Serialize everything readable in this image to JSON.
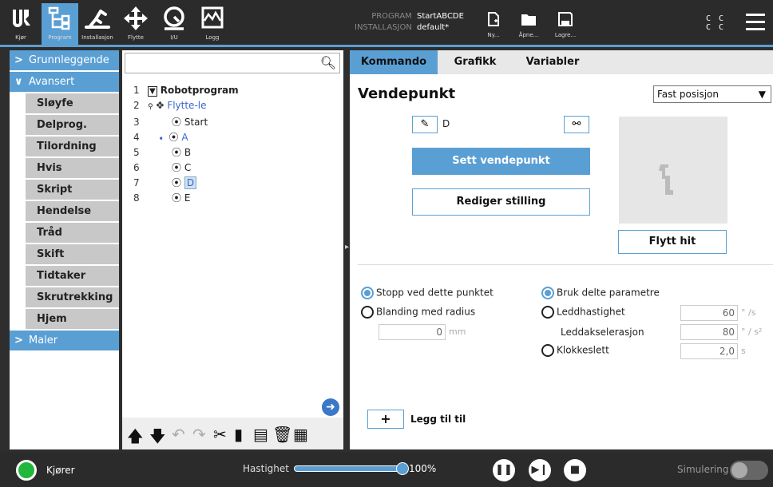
{
  "topbar": {
    "tabs": [
      {
        "label": "Kjør",
        "icon": "ur-logo-icon"
      },
      {
        "label": "Program",
        "icon": "program-icon"
      },
      {
        "label": "Installasjon",
        "icon": "installation-icon"
      },
      {
        "label": "Flytte",
        "icon": "move-icon"
      },
      {
        "label": "I/U",
        "icon": "io-icon"
      },
      {
        "label": "Logg",
        "icon": "log-icon"
      }
    ],
    "program_label": "PROGRAM",
    "program_value": "StartABCDE",
    "installation_label": "INSTALLASJON",
    "installation_value": "default*",
    "new_label": "Ny...",
    "open_label": "Åpne...",
    "save_label": "Lagre...",
    "cc_line1": "C C",
    "cc_line2": "C C"
  },
  "sidebar": {
    "basic": "Grunnleggende",
    "advanced": "Avansert",
    "items": [
      "Sløyfe",
      "Delprog.",
      "Tilordning",
      "Hvis",
      "Skript",
      "Hendelse",
      "Tråd",
      "Skift",
      "Tidtaker",
      "Skrutrekking",
      "Hjem"
    ],
    "templates": "Maler"
  },
  "tree": {
    "rows": [
      {
        "num": "1",
        "label": "Robotprogram"
      },
      {
        "num": "2",
        "label": "Flytte-le"
      },
      {
        "num": "3",
        "label": "Start"
      },
      {
        "num": "4",
        "label": "A"
      },
      {
        "num": "5",
        "label": "B"
      },
      {
        "num": "6",
        "label": "C"
      },
      {
        "num": "7",
        "label": "D"
      },
      {
        "num": "8",
        "label": "E"
      }
    ]
  },
  "panel": {
    "tabs": [
      "Kommando",
      "Grafikk",
      "Variabler"
    ],
    "title": "Vendepunkt",
    "position_type": "Fast posisjon",
    "waypoint_name": "D",
    "set_waypoint": "Sett vendepunkt",
    "edit_pose": "Rediger stilling",
    "move_here": "Flytt hit",
    "stop_here": "Stopp ved dette punktet",
    "blend_radius": "Blanding med radius",
    "blend_value": "0",
    "blend_unit": "mm",
    "shared_params": "Bruk delte parametre",
    "joint_speed": "Leddhastighet",
    "joint_speed_value": "60",
    "joint_speed_unit": "° /s",
    "joint_accel": "Leddakselerasjon",
    "joint_accel_value": "80",
    "joint_accel_unit": "° / s²",
    "time": "Klokkeslett",
    "time_value": "2,0",
    "time_unit": "s",
    "add_until": "Legg til til"
  },
  "bottom": {
    "status": "Kjører",
    "speed_label": "Hastighet",
    "speed_value": "100%",
    "speed_fraction": 1.0,
    "simulation": "Simulering"
  }
}
